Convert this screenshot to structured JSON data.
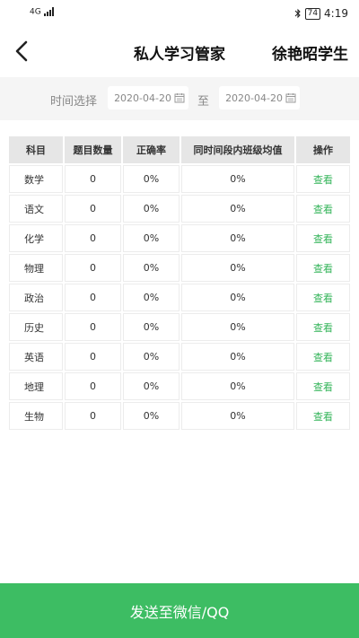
{
  "status_bar": {
    "signal": "4G",
    "battery": "74",
    "time": "4:19"
  },
  "header": {
    "title": "私人学习管家",
    "student": "徐艳昭学生"
  },
  "filter": {
    "label": "时间选择",
    "date_from": "2020-04-20",
    "separator": "至",
    "date_to": "2020-04-20"
  },
  "table": {
    "headers": [
      "科目",
      "题目数量",
      "正确率",
      "同时间段内班级均值",
      "操作"
    ],
    "rows": [
      {
        "subject": "数学",
        "count": "0",
        "accuracy": "0%",
        "class_avg": "0%",
        "action": "查看"
      },
      {
        "subject": "语文",
        "count": "0",
        "accuracy": "0%",
        "class_avg": "0%",
        "action": "查看"
      },
      {
        "subject": "化学",
        "count": "0",
        "accuracy": "0%",
        "class_avg": "0%",
        "action": "查看"
      },
      {
        "subject": "物理",
        "count": "0",
        "accuracy": "0%",
        "class_avg": "0%",
        "action": "查看"
      },
      {
        "subject": "政治",
        "count": "0",
        "accuracy": "0%",
        "class_avg": "0%",
        "action": "查看"
      },
      {
        "subject": "历史",
        "count": "0",
        "accuracy": "0%",
        "class_avg": "0%",
        "action": "查看"
      },
      {
        "subject": "英语",
        "count": "0",
        "accuracy": "0%",
        "class_avg": "0%",
        "action": "查看"
      },
      {
        "subject": "地理",
        "count": "0",
        "accuracy": "0%",
        "class_avg": "0%",
        "action": "查看"
      },
      {
        "subject": "生物",
        "count": "0",
        "accuracy": "0%",
        "class_avg": "0%",
        "action": "查看"
      }
    ]
  },
  "footer": {
    "send_label": "发送至微信/QQ"
  },
  "colors": {
    "accent": "#3dbd63",
    "link": "#34b45a",
    "filter_bg": "#f5f5f5",
    "header_cell_bg": "#e6e6e6"
  },
  "icons": {
    "back": "chevron-left-icon",
    "calendar": "calendar-icon",
    "bluetooth": "bluetooth-icon",
    "battery": "battery-icon",
    "signal": "signal-icon"
  }
}
